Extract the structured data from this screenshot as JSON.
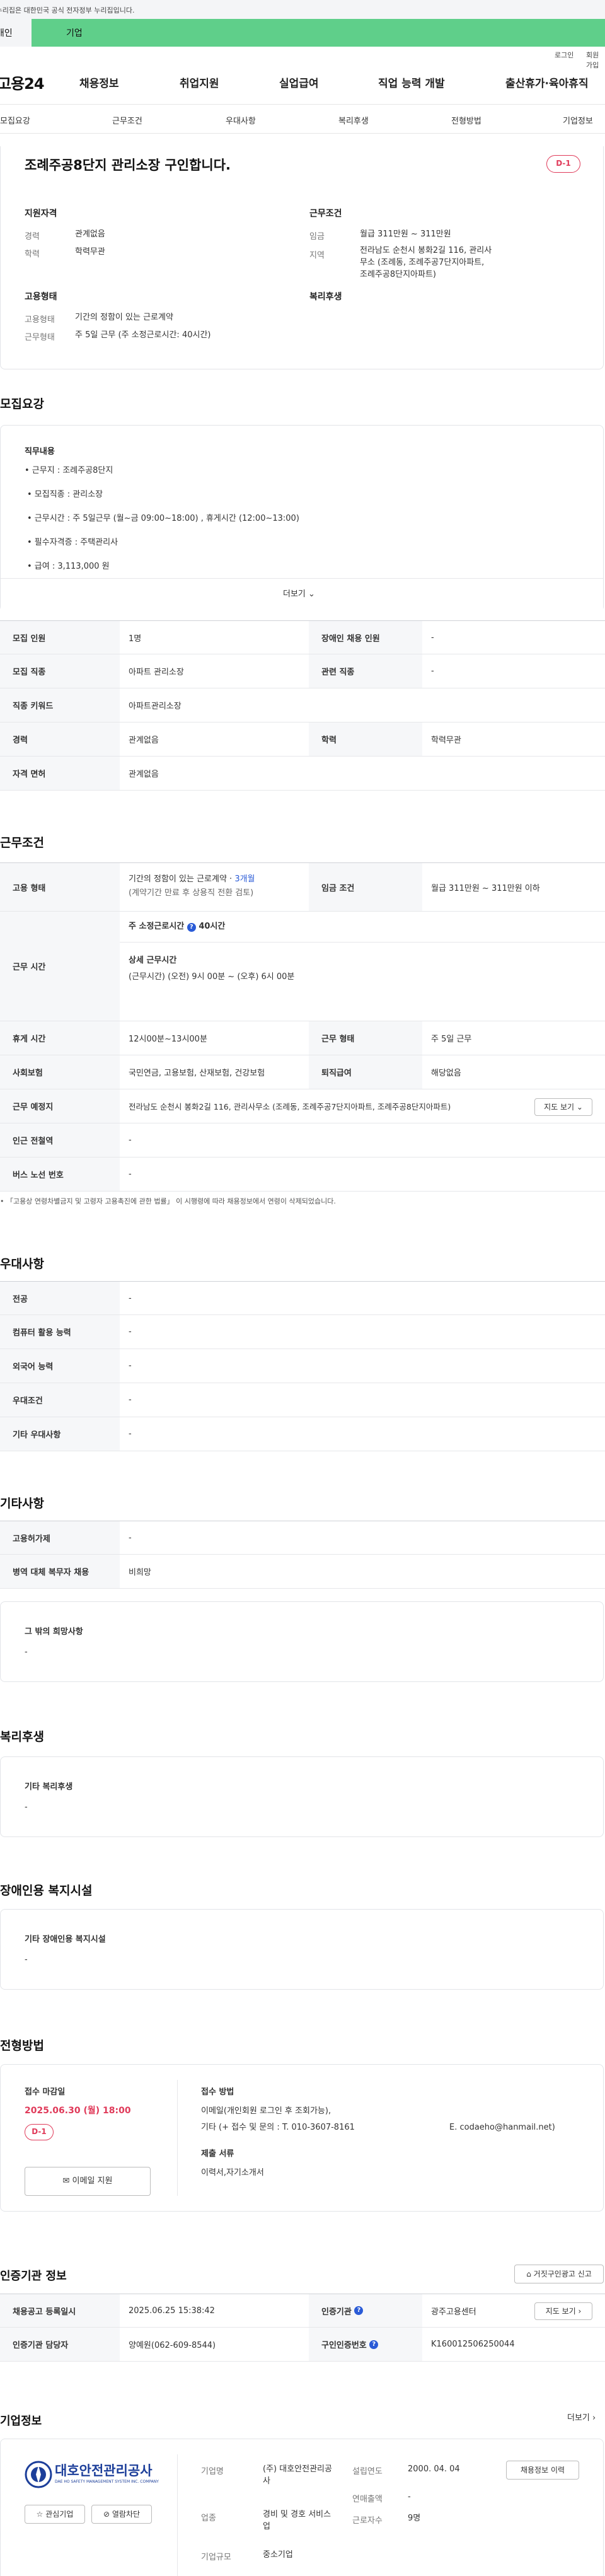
{
  "gov_banner": "이 누리집은 대한민국 공식 전자정부 누리집입니다.",
  "top_tabs": [
    "개인",
    "기업"
  ],
  "util": [
    "로그인",
    "회원가입"
  ],
  "logo": "고용24",
  "gnb": [
    "채용정보",
    "취업지원",
    "실업급여",
    "직업 능력 개발",
    "출산휴가·육아휴직"
  ],
  "anchor_tabs": [
    "모집요강",
    "근무조건",
    "우대사항",
    "복리후생",
    "전형방법",
    "기업정보"
  ],
  "summary": {
    "title": "조례주공8단지 관리소장 구인합니다.",
    "dday": "D-1",
    "qual_title": "지원자격",
    "career_l": "경력",
    "career_v": "관계없음",
    "edu_l": "학력",
    "edu_v": "학력무관",
    "cond_title": "근무조건",
    "wage_l": "임금",
    "wage_v": "월급 311만원 ~ 311만원",
    "region_l": "지역",
    "region_v": "전라남도 순천시 봉화2길 116, 관리사무소 (조례동, 조례주공7단지아파트, 조례주공8단지아파트)",
    "emp_title": "고용형태",
    "emp_l": "고용형태",
    "emp_v": "기간의 정함이 있는 근로계약",
    "work_l": "근무형태",
    "work_v": "주 5일 근무 (주 소정근로시간: 40시간)",
    "welfare_title": "복리후생"
  },
  "recruit": {
    "title": "모집요강",
    "duty_title": "직무내용",
    "duty_lines": [
      "• 근무지 : 조례주공8단지",
      "• 모집직종 :  관리소장",
      "• 근무시간 : 주 5일근무 (월~금 09:00~18:00) , 휴게시간 (12:00~13:00)",
      "• 필수자격증 : 주택관리사",
      "• 급여 :  3,113,000 원"
    ],
    "more": "더보기",
    "rows": [
      {
        "a": "모집 인원",
        "b": "1명",
        "c": "장애인 채용 인원",
        "d": "-"
      },
      {
        "a": "모집 직종",
        "b": "아파트 관리소장",
        "c": "관련 직종",
        "d": "-"
      },
      {
        "a": "직종 키워드",
        "b": "아파트관리소장"
      },
      {
        "a": "경력",
        "b": "관계없음",
        "c": "학력",
        "d": "학력무관"
      },
      {
        "a": "자격 면허",
        "b": "관계없음"
      }
    ]
  },
  "conditions": {
    "title": "근무조건",
    "emp_l": "고용 형태",
    "emp_v1": "기간의 정함이 있는 근로계약 · ",
    "emp_v1b": "3개월",
    "emp_v2": "(계약기간 만료 후 상용직 전환 검토)",
    "wage_l": "임금 조건",
    "wage_v": "월급 311만원 ~ 311만원 이하",
    "time_l": "근무 시간",
    "time_a": "주 소정근로시간",
    "time_b": "40시간",
    "time_c": "상세 근무시간",
    "time_d": "(근무시간) (오전) 9시 00분 ~ (오후) 6시 00분",
    "rows": [
      {
        "a": "휴게 시간",
        "b": "12시00분~13시00분",
        "c": "근무 형태",
        "d": "주 5일 근무"
      },
      {
        "a": "사회보험",
        "b": "국민연금, 고용보험, 산재보험, 건강보험",
        "c": "퇴직급여",
        "d": "해당없음"
      },
      {
        "a": "근무 예정지",
        "b": "전라남도 순천시 봉화2길 116, 관리사무소 (조례동, 조례주공7단지아파트, 조례주공8단지아파트)",
        "btn": "지도 보기"
      },
      {
        "a": "인근 전철역",
        "b": "-"
      },
      {
        "a": "버스 노선 번호",
        "b": "-"
      }
    ],
    "note": "• 「고용상 연령차별금지 및 고령자 고용촉진에 관한 법률」 이 시행령에 따라 채용정보에서 연령이 삭제되었습니다."
  },
  "preferences": {
    "title": "우대사항",
    "rows": [
      {
        "a": "전공",
        "b": "-"
      },
      {
        "a": "컴퓨터 활용 능력",
        "b": "-"
      },
      {
        "a": "외국어 능력",
        "b": "-"
      },
      {
        "a": "우대조건",
        "b": "-"
      },
      {
        "a": "기타 우대사항",
        "b": "-"
      }
    ]
  },
  "other": {
    "title": "기타사항",
    "rows": [
      {
        "a": "고용허가제",
        "b": "-"
      },
      {
        "a": "병역 대체 복무자 채용",
        "b": "비희망"
      }
    ],
    "box_t": "그 밖의 희망사항",
    "box_v": "-"
  },
  "welfare": {
    "title": "복리후생",
    "box_t": "기타 복리후생",
    "box_v": "-"
  },
  "disability": {
    "title": "장애인용 복지시설",
    "box_t": "기타 장애인용 복지시설",
    "box_v": "-"
  },
  "selection": {
    "title": "전형방법",
    "deadline_l": "접수 마감일",
    "deadline_v": "2025.06.30 (월) 18:00",
    "dday": "D-1",
    "email_btn": "이메일 지원",
    "method_l": "접수 방법",
    "method_1": "이메일(개인회원 로그인 후 조회가능),",
    "method_2": "기타 (+ 접수 및 문의 : T. 010-3607-8161",
    "method_3": "E. codaeho@hanmail.net)",
    "docs_l": "제출 서류",
    "docs_v": "이력서,자기소개서"
  },
  "cert": {
    "title": "인증기관 정보",
    "report_btn": "거짓구인광고 신고",
    "rows": [
      {
        "a": "채용공고 등록일시",
        "b": "2025.06.25 15:38:42",
        "c": "인증기관",
        "d": "광주고용센터",
        "btn": "지도 보기"
      },
      {
        "a": "인증기관 담당자",
        "b": "양예원(062-609-8544)",
        "c": "구인인증번호",
        "d": "K160012506250044"
      }
    ]
  },
  "company": {
    "title": "기업정보",
    "more": "더보기",
    "logo_text": "대호안전관리공사",
    "logo_sub": "DAE HO SAFETY MANAGEMENT SYSTEM INC. COMPANY",
    "fav_btn": "관심기업",
    "block_btn": "열람차단",
    "name_l": "기업명",
    "name_v": "(주) 대호안전관리공사",
    "est_l": "설립연도",
    "est_v": "2000. 04. 04",
    "recruit_btn": "채용정보 이력",
    "biz_l": "업종",
    "biz_v": "경비 및 경호 서비스업",
    "rev_l": "연매출액",
    "rev_v": "-",
    "emp_l": "근로자수",
    "emp_v": "9명",
    "size_l": "기업규모",
    "size_v": "중소기업"
  },
  "colors": {
    "green": "#5fcf8a",
    "red": "#e03b5a",
    "blue": "#2a5bd7"
  }
}
